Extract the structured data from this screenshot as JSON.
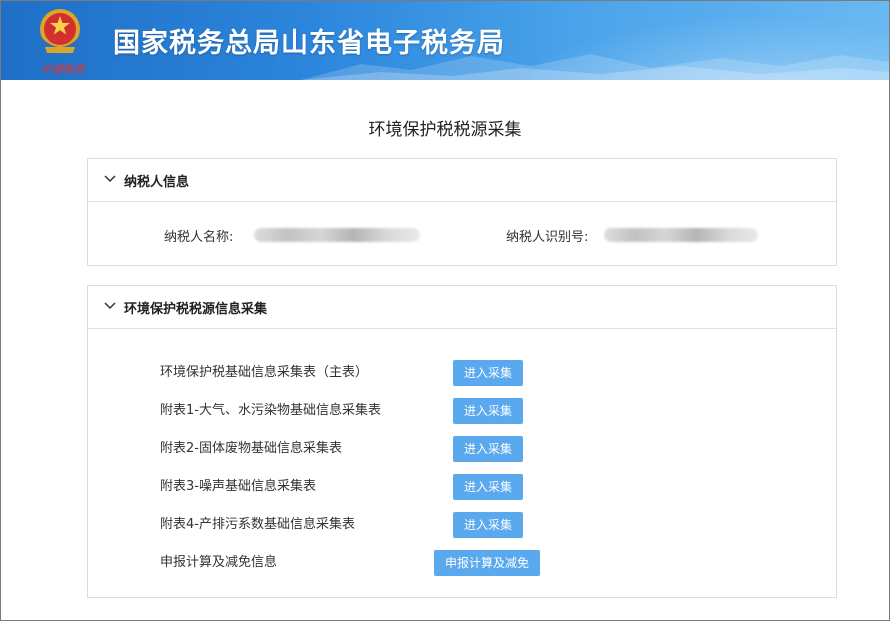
{
  "banner": {
    "title": "国家税务总局山东省电子税务局",
    "emblem_caption": "中国税务",
    "emblem_icon": "tax-emblem-icon"
  },
  "page": {
    "title": "环境保护税税源采集"
  },
  "taxpayer_panel": {
    "title": "纳税人信息",
    "name_label": "纳税人名称:",
    "id_label": "纳税人识别号:"
  },
  "collection_panel": {
    "title": "环境保护税税源信息采集",
    "items": [
      {
        "label": "环境保护税基础信息采集表（主表）",
        "button": "进入采集"
      },
      {
        "label": "附表1-大气、水污染物基础信息采集表",
        "button": "进入采集"
      },
      {
        "label": "附表2-固体废物基础信息采集表",
        "button": "进入采集"
      },
      {
        "label": "附表3-噪声基础信息采集表",
        "button": "进入采集"
      },
      {
        "label": "附表4-产排污系数基础信息采集表",
        "button": "进入采集"
      },
      {
        "label": "申报计算及减免信息",
        "button": "申报计算及减免"
      }
    ]
  },
  "colors": {
    "banner_start": "#1f6fc6",
    "banner_end": "#69b8f2",
    "button": "#5aa9ee",
    "emblem_red": "#e53030"
  }
}
